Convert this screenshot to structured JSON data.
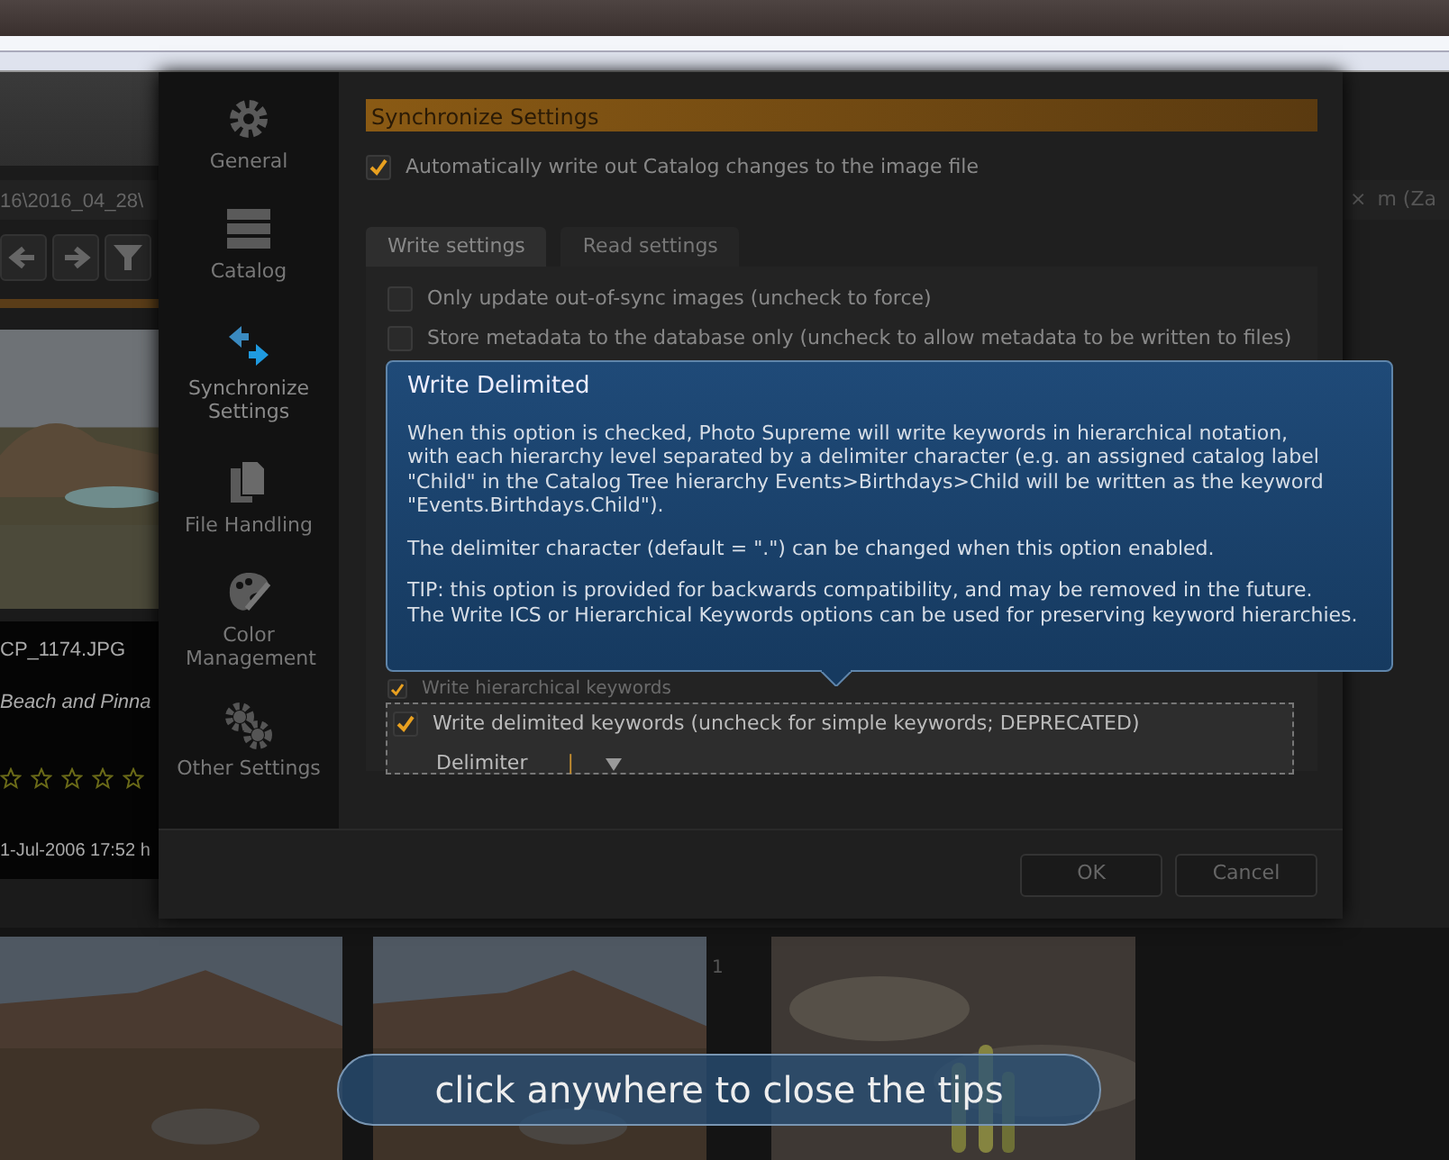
{
  "background": {
    "path": "16\\2016_04_28\\",
    "file_name": "CP_1174.JPG",
    "caption": "Beach and Pinna",
    "stars": 0,
    "date": "1-Jul-2006 17:52 h",
    "tab_label": "m (Za",
    "tab_close": "×",
    "page_badge": "1"
  },
  "dialog": {
    "sidebar": [
      {
        "label": "General",
        "kind": "gear",
        "selected": false
      },
      {
        "label": "Catalog",
        "kind": "stack",
        "selected": false
      },
      {
        "label": "Synchronize Settings",
        "kind": "sync",
        "selected": true
      },
      {
        "label": "File Handling",
        "kind": "files",
        "selected": false
      },
      {
        "label": "Color Management",
        "kind": "palette",
        "selected": false
      },
      {
        "label": "Other Settings",
        "kind": "gears",
        "selected": false
      }
    ],
    "section_title": "Synchronize Settings",
    "auto_write": {
      "label": "Automatically write out Catalog changes to the image file",
      "checked": true
    },
    "tabs": [
      {
        "label": "Write settings",
        "selected": true
      },
      {
        "label": "Read settings",
        "selected": false
      }
    ],
    "options": [
      {
        "label": "Only update out-of-sync images (uncheck to force)",
        "checked": false
      },
      {
        "label": "Store metadata to the database only (uncheck to allow metadata to be written to files)",
        "checked": false
      }
    ],
    "hierarchical": {
      "label": "Write hierarchical keywords",
      "checked": true
    },
    "delimited": {
      "label": "Write delimited keywords (uncheck for simple keywords; DEPRECATED)",
      "checked": true,
      "delimiter_label": "Delimiter",
      "delimiter_value": "|"
    },
    "buttons": [
      "OK",
      "Cancel"
    ]
  },
  "tooltip": {
    "title": "Write Delimited",
    "paragraphs": [
      {
        "lines": [
          "When this option is checked, Photo Supreme will write keywords in hierarchical notation,",
          "with each hierarchy level separated by a delimiter character (e.g. an assigned catalog label",
          "\"Child\" in the Catalog Tree hierarchy Events>Birthdays>Child will be written as the keyword",
          "\"Events.Birthdays.Child\")."
        ]
      },
      {
        "lines": [
          "The delimiter character (default = \".\") can be changed when this option enabled."
        ]
      },
      {
        "lines": [
          "TIP: this option is provided for backwards compatibility, and may be removed in the future.",
          "The Write ICS or Hierarchical Keywords options can be used for preserving keyword hierarchies."
        ]
      }
    ]
  },
  "tip_banner": "click anywhere to close the tips"
}
